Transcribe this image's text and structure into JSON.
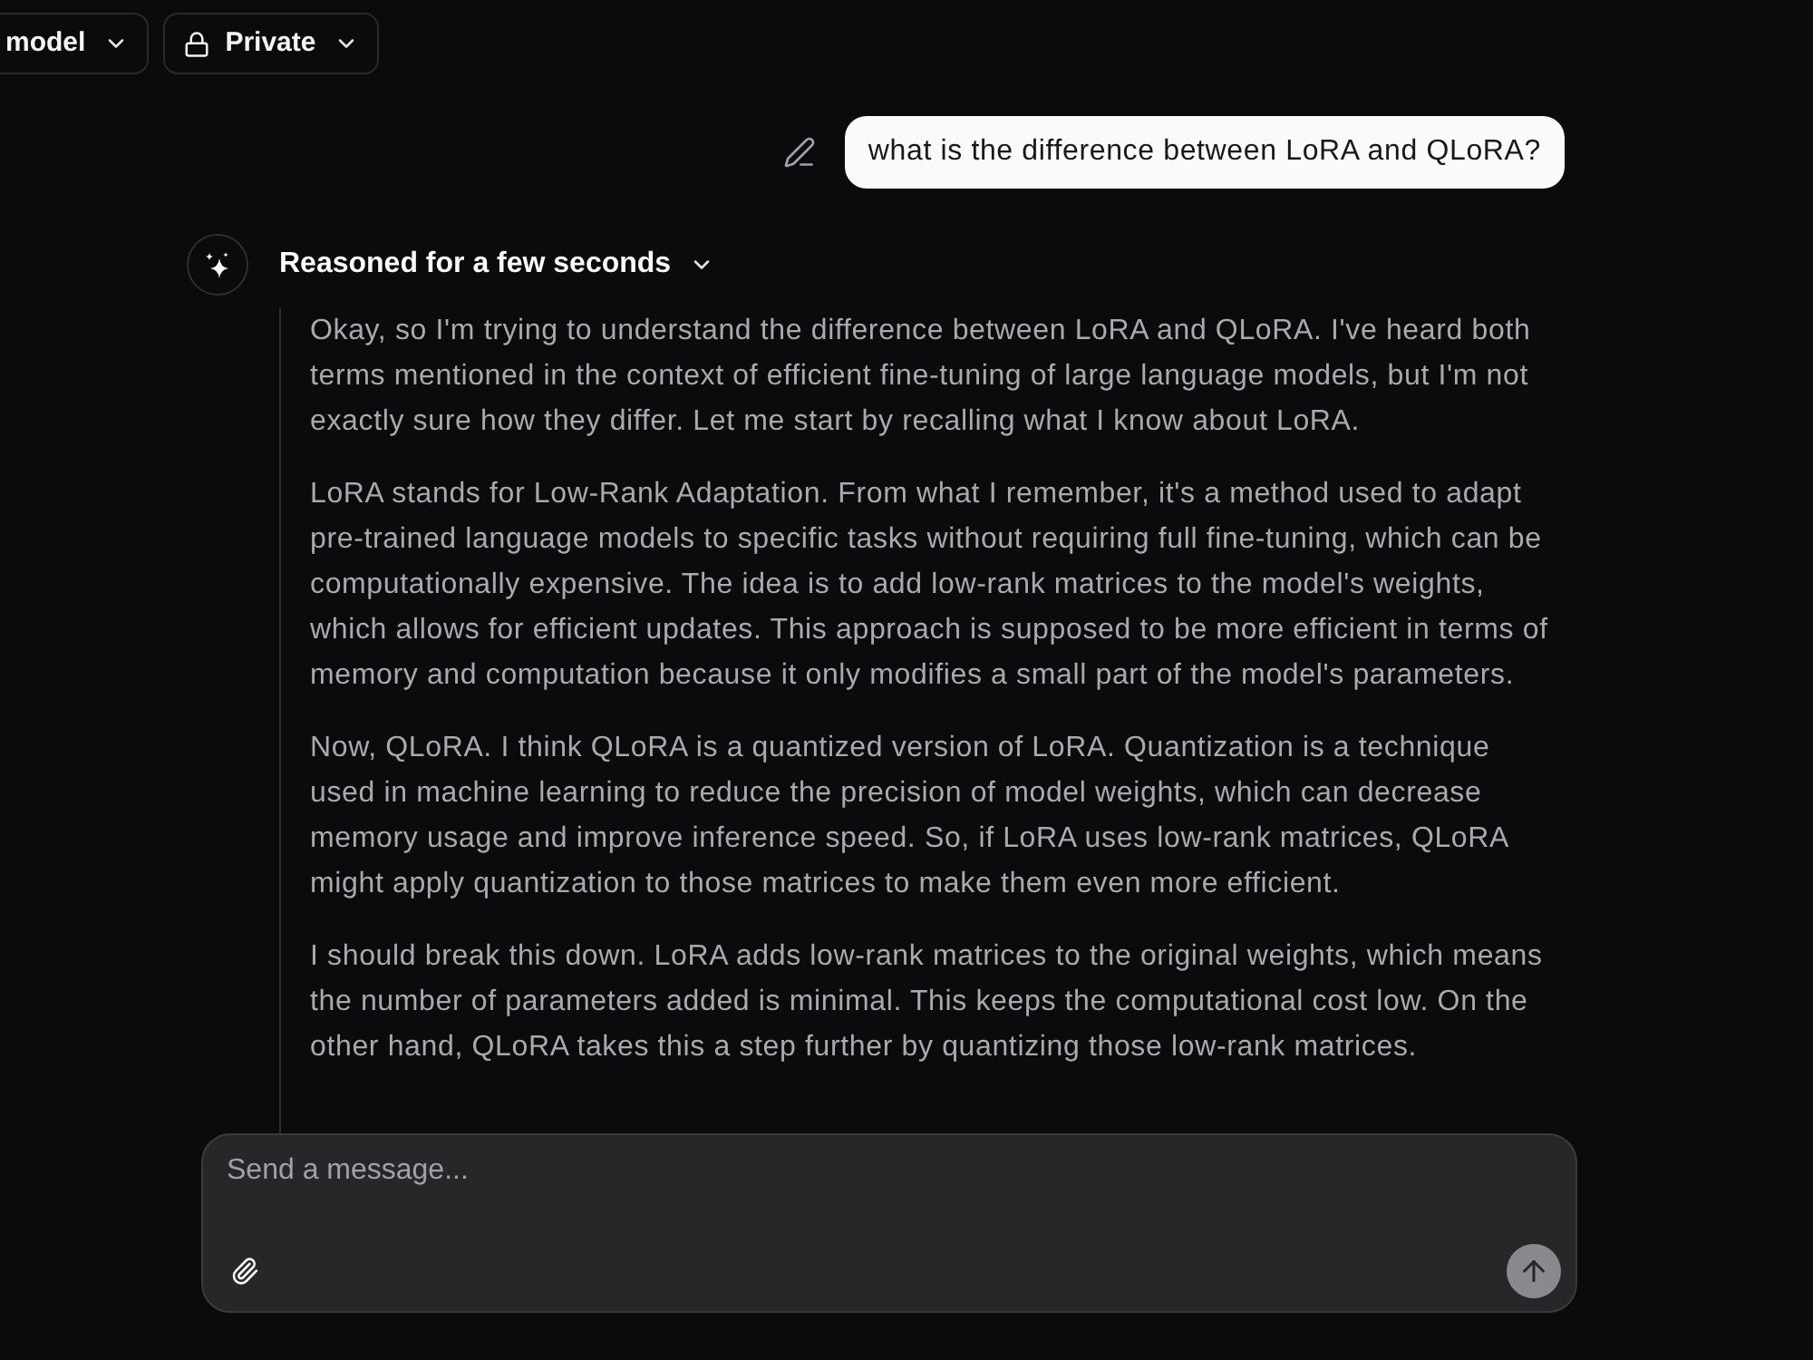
{
  "model_selector": {
    "label": "model"
  },
  "visibility_selector": {
    "label": "Private"
  },
  "user_message": {
    "text": "what is the difference between LoRA and QLoRA?"
  },
  "reasoning": {
    "label": "Reasoned for a few seconds",
    "expanded": true,
    "paragraphs": [
      "Okay, so I'm trying to understand the difference between LoRA and QLoRA. I've heard both terms mentioned in the context of efficient fine-tuning of large language models, but I'm not exactly sure how they differ. Let me start by recalling what I know about LoRA.",
      "LoRA stands for Low-Rank Adaptation. From what I remember, it's a method used to adapt pre-trained language models to specific tasks without requiring full fine-tuning, which can be computationally expensive. The idea is to add low-rank matrices to the model's weights, which allows for efficient updates. This approach is supposed to be more efficient in terms of memory and computation because it only modifies a small part of the model's parameters.",
      "Now, QLoRA. I think QLoRA is a quantized version of LoRA. Quantization is a technique used in machine learning to reduce the precision of model weights, which can decrease memory usage and improve inference speed. So, if LoRA uses low-rank matrices, QLoRA might apply quantization to those matrices to make them even more efficient.",
      "I should break this down. LoRA adds low-rank matrices to the original weights, which means the number of parameters added is minimal. This keeps the computational cost low. On the other hand, QLoRA takes this a step further by quantizing those low-rank matrices."
    ]
  },
  "composer": {
    "placeholder": "Send a message...",
    "send_disabled": true
  }
}
